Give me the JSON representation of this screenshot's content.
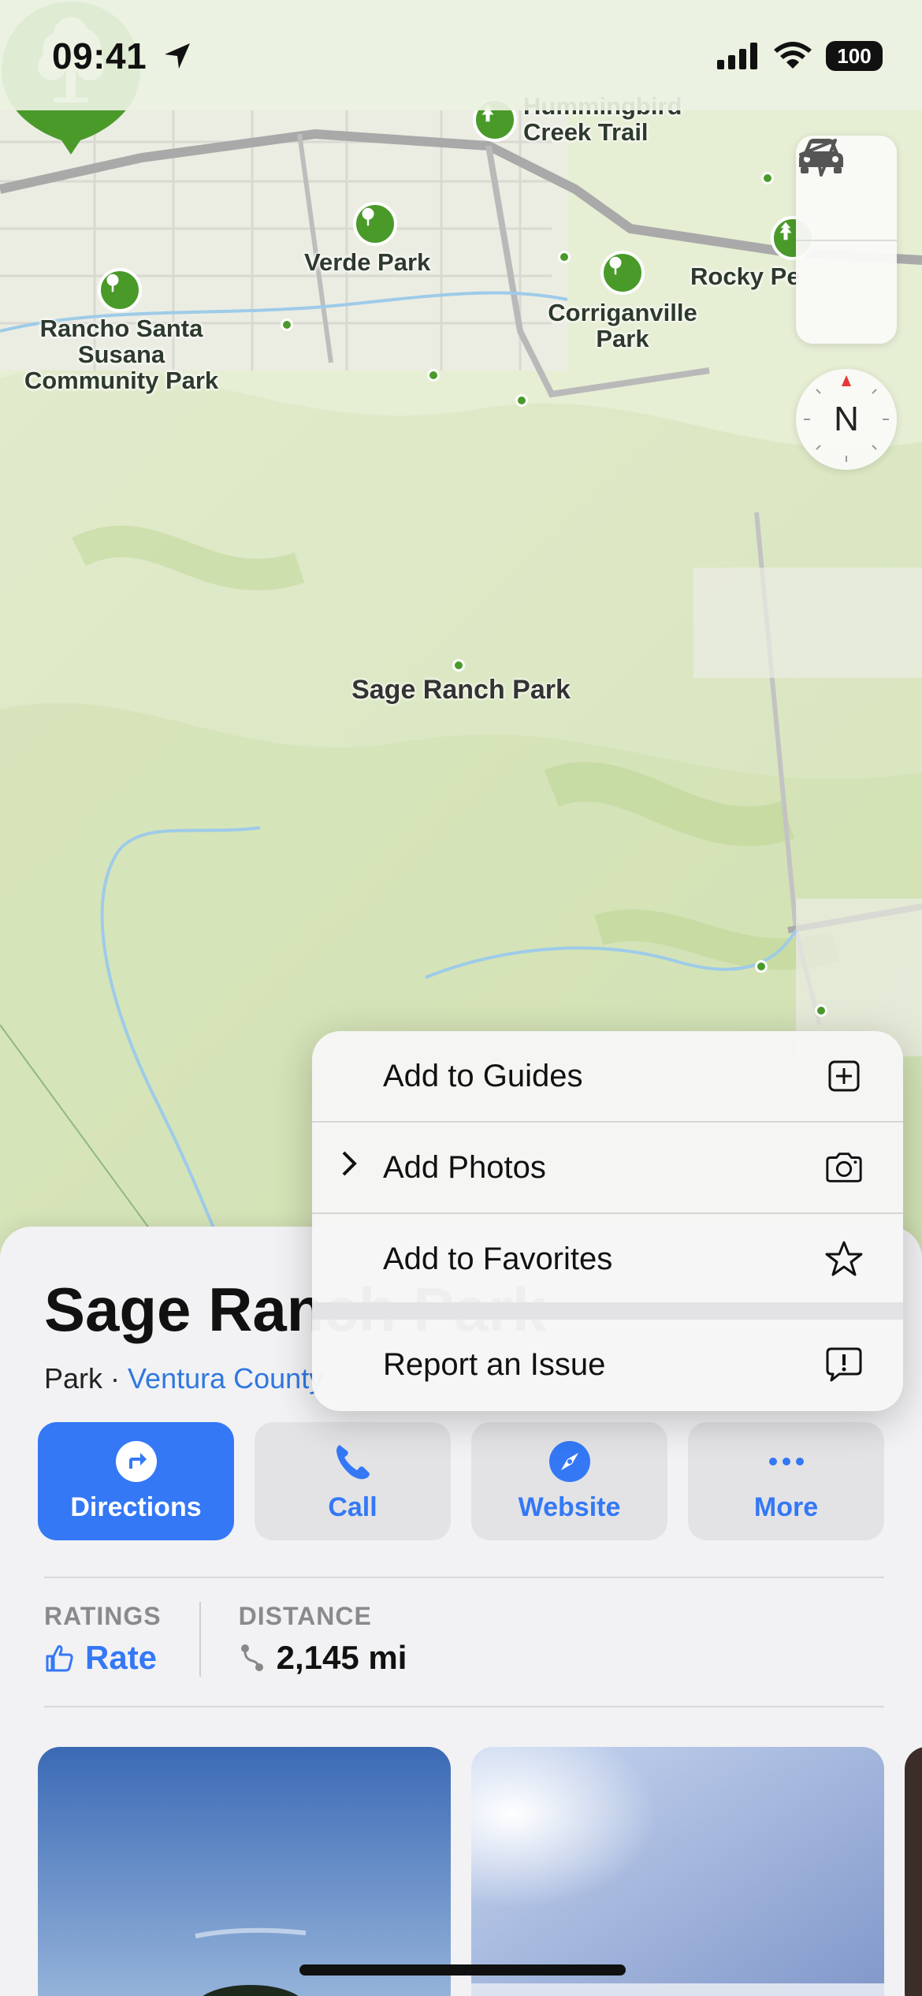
{
  "status_bar": {
    "time": "09:41",
    "battery": "100"
  },
  "map": {
    "labels": {
      "hummingbird": "Hummingbird\nCreek Trail",
      "verde": "Verde Park",
      "rocky": "Rocky Pe",
      "rancho": "Rancho Santa\nSusana\nCommunity Park",
      "corriganville": "Corriganville\nPark",
      "selected": "Sage Ranch Park"
    },
    "compass": "N"
  },
  "place": {
    "title": "Sage Ranch Park",
    "category": "Park",
    "separator": " · ",
    "region": "Ventura County"
  },
  "actions": [
    {
      "label": "Directions",
      "icon": "directions-arrow-icon"
    },
    {
      "label": "Call",
      "icon": "phone-icon"
    },
    {
      "label": "Website",
      "icon": "compass-icon"
    },
    {
      "label": "More",
      "icon": "ellipsis-icon"
    }
  ],
  "info": {
    "ratings_header": "RATINGS",
    "ratings_value": "Rate",
    "distance_header": "DISTANCE",
    "distance_value": "2,145 mi"
  },
  "context_menu": {
    "items": [
      {
        "label": "Add to Guides",
        "icon": "plus-square-icon"
      },
      {
        "label": "Add Photos",
        "icon": "camera-icon"
      },
      {
        "label": "Add to Favorites",
        "icon": "star-icon"
      },
      {
        "label": "Report an Issue",
        "icon": "exclamation-bubble-icon"
      }
    ]
  },
  "colors": {
    "accent": "#3478f6",
    "park_green": "#4a9a2a",
    "map_bg": "#e7efd6"
  }
}
